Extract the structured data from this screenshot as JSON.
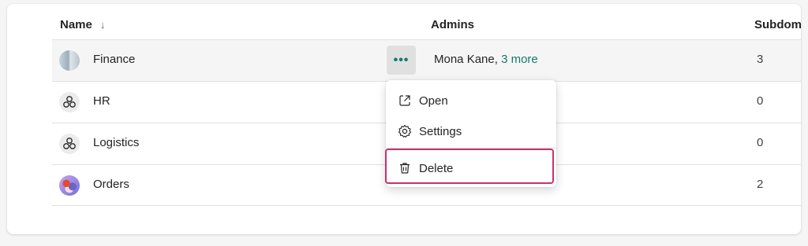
{
  "columns": {
    "name": "Name",
    "admins": "Admins",
    "subdomains": "Subdom"
  },
  "rows": [
    {
      "name": "Finance",
      "admins_primary": "Mona Kane, ",
      "admins_more": "3 more",
      "subdomains": "3",
      "icon": "finance-avatar-icon"
    },
    {
      "name": "HR",
      "subdomains": "0",
      "icon": "triad-icon"
    },
    {
      "name": "Logistics",
      "subdomains": "0",
      "icon": "triad-icon"
    },
    {
      "name": "Orders",
      "subdomains": "2",
      "icon": "orders-avatar-icon"
    }
  ],
  "more_button": {
    "label": "•••"
  },
  "context_menu": {
    "items": [
      {
        "label": "Open",
        "icon": "open-in-new-icon"
      },
      {
        "label": "Settings",
        "icon": "gear-icon"
      },
      {
        "label": "Delete",
        "icon": "trash-icon"
      }
    ]
  },
  "colors": {
    "accent": "#107c6c",
    "highlight_border": "#c8326e"
  }
}
